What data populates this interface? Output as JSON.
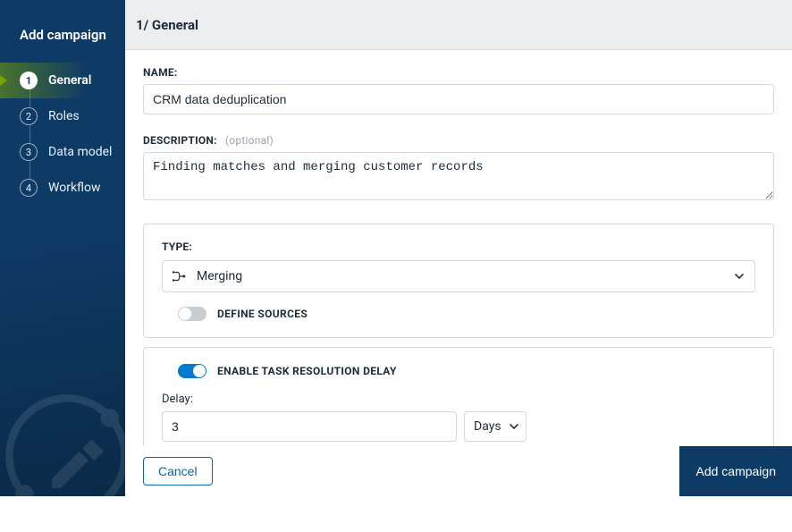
{
  "sidebar": {
    "title": "Add campaign",
    "steps": [
      {
        "num": "1",
        "label": "General",
        "active": true
      },
      {
        "num": "2",
        "label": "Roles",
        "active": false
      },
      {
        "num": "3",
        "label": "Data model",
        "active": false
      },
      {
        "num": "4",
        "label": "Workflow",
        "active": false
      }
    ]
  },
  "header": {
    "title": "1/ General"
  },
  "form": {
    "name_label": "NAME:",
    "name_value": "CRM data deduplication",
    "desc_label": "DESCRIPTION:",
    "desc_optional": "(optional)",
    "desc_value": "Finding matches and merging customer records",
    "type_label": "TYPE:",
    "type_value": "Merging",
    "define_sources_label": "DEFINE SOURCES",
    "define_sources_on": false,
    "enable_delay_label": "ENABLE TASK RESOLUTION DELAY",
    "enable_delay_on": true,
    "delay_label": "Delay:",
    "delay_value": "3",
    "delay_unit": "Days"
  },
  "footer": {
    "cancel": "Cancel",
    "submit": "Add campaign"
  }
}
